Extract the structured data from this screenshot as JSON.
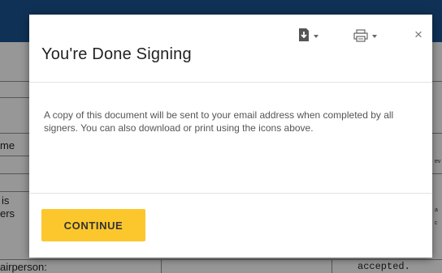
{
  "background_document": {
    "field_label_1": "me",
    "field_label_2": "is",
    "field_label_3": "ers",
    "field_label_4": "airperson:",
    "right_text_1": "accepted.",
    "right_text_2": "a",
    "right_text_3": "c",
    "right_text_4": "ev"
  },
  "dialog": {
    "title": "You're Done Signing",
    "body": "A copy of this document will be sent to your email address when completed by all signers. You can also download or print using the icons above.",
    "close_label": "×",
    "continue_label": "CONTINUE"
  },
  "icons": {
    "download": "download-icon",
    "print": "print-icon",
    "close": "close-icon"
  },
  "colors": {
    "header_bar": "#1a4f8b",
    "continue_button": "#fcc72d",
    "dialog_background": "#ffffff"
  }
}
